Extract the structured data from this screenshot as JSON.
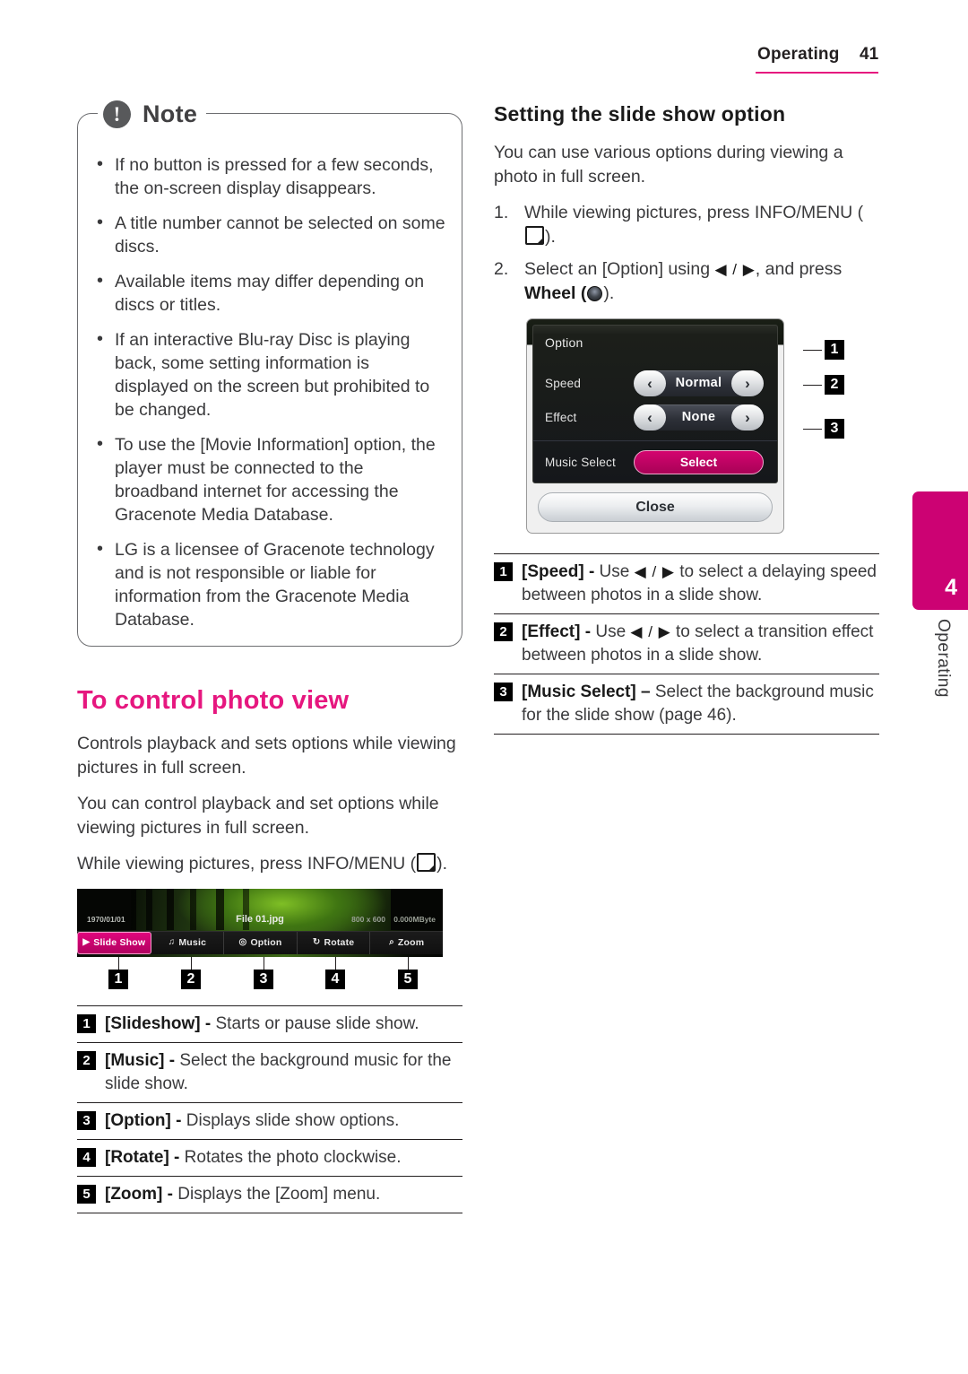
{
  "header": {
    "section": "Operating",
    "page_number": "41"
  },
  "side_tab": {
    "chapter_number": "4",
    "chapter_label": "Operating"
  },
  "note": {
    "icon": "exclamation-icon",
    "title": "Note",
    "items": [
      "If no button is pressed for a few seconds, the on-screen display disappears.",
      "A title number cannot be selected on some discs.",
      "Available items may differ depending on discs or titles.",
      "If an interactive Blu-ray Disc is playing back, some setting information is displayed on the screen but prohibited to be changed.",
      "To use the [Movie Information] option, the player must be connected to the broadband internet for accessing the Gracenote Media Database.",
      "LG is a licensee of Gracenote technology and is not responsible or liable for information from the Gracenote Media Database."
    ]
  },
  "photo_view": {
    "heading": "To control photo view",
    "paragraph_1": "Controls playback and sets options while viewing pictures in full screen.",
    "paragraph_2": "You can control playback and set options while viewing pictures in full screen.",
    "paragraph_3_pre": "While viewing pictures, press INFO/MENU (",
    "paragraph_3_post": ").",
    "osd": {
      "date": "1970/01/01",
      "file_name": "File 01.jpg",
      "resolution": "800 x 600",
      "file_size": "0.000MByte",
      "buttons": [
        {
          "label": "Slide Show",
          "glyph": "▶",
          "icon": "play-icon",
          "selected": true
        },
        {
          "label": "Music",
          "glyph": "♫",
          "icon": "music-note-icon",
          "selected": false
        },
        {
          "label": "Option",
          "glyph": "◎",
          "icon": "option-gear-icon",
          "selected": false
        },
        {
          "label": "Rotate",
          "glyph": "↻",
          "icon": "rotate-icon",
          "selected": false
        },
        {
          "label": "Zoom",
          "glyph": "⌕",
          "icon": "magnifier-icon",
          "selected": false
        }
      ],
      "callouts": [
        "1",
        "2",
        "3",
        "4",
        "5"
      ]
    },
    "legend": [
      {
        "num": "1",
        "term": "[Slideshow] -",
        "desc": " Starts or pause slide show."
      },
      {
        "num": "2",
        "term": "[Music] -",
        "desc": " Select the background music for the slide show."
      },
      {
        "num": "3",
        "term": "[Option] -",
        "desc": " Displays slide show options."
      },
      {
        "num": "4",
        "term": "[Rotate] -",
        "desc": " Rotates the photo clockwise."
      },
      {
        "num": "5",
        "term": "[Zoom] -",
        "desc": " Displays the [Zoom] menu."
      }
    ]
  },
  "slide_show_option": {
    "heading": "Setting the slide show option",
    "intro": "You can use various options during viewing a photo in full screen.",
    "steps": [
      {
        "num": "1.",
        "text_pre": "While viewing pictures, press INFO/MENU (",
        "text_post": ")."
      },
      {
        "num": "2.",
        "text_pre": "Select an [Option] using ",
        "arrows": "◀ / ▶",
        "text_mid": ", and press ",
        "wheel_label": "Wheel",
        "text_post": ")."
      }
    ],
    "dialog": {
      "title": "Option",
      "rows": [
        {
          "label": "Speed",
          "value": "Normal",
          "left_arrow": "‹",
          "right_arrow": "›"
        },
        {
          "label": "Effect",
          "value": "None",
          "left_arrow": "‹",
          "right_arrow": "›"
        }
      ],
      "music_row": {
        "label": "Music Select",
        "button": "Select"
      },
      "close_button": "Close",
      "callouts": [
        "1",
        "2",
        "3"
      ]
    },
    "legend": [
      {
        "num": "1",
        "term": "[Speed] -",
        "desc_pre": " Use ",
        "arrows": "◀ / ▶",
        "desc_post": " to select a delaying speed between photos in a slide show."
      },
      {
        "num": "2",
        "term": "[Effect] -",
        "desc_pre": " Use ",
        "arrows": "◀ / ▶",
        "desc_post": " to select a transition effect between photos in a slide show."
      },
      {
        "num": "3",
        "term": "[Music Select] –",
        "desc_pre": " Select the background music for the slide show (page 46).",
        "arrows": "",
        "desc_post": ""
      }
    ]
  },
  "colors": {
    "brand_pink": "#e6177f",
    "tab_pink": "#cc0273",
    "osd_selected": "#d4046f",
    "ink": "#231f20"
  }
}
